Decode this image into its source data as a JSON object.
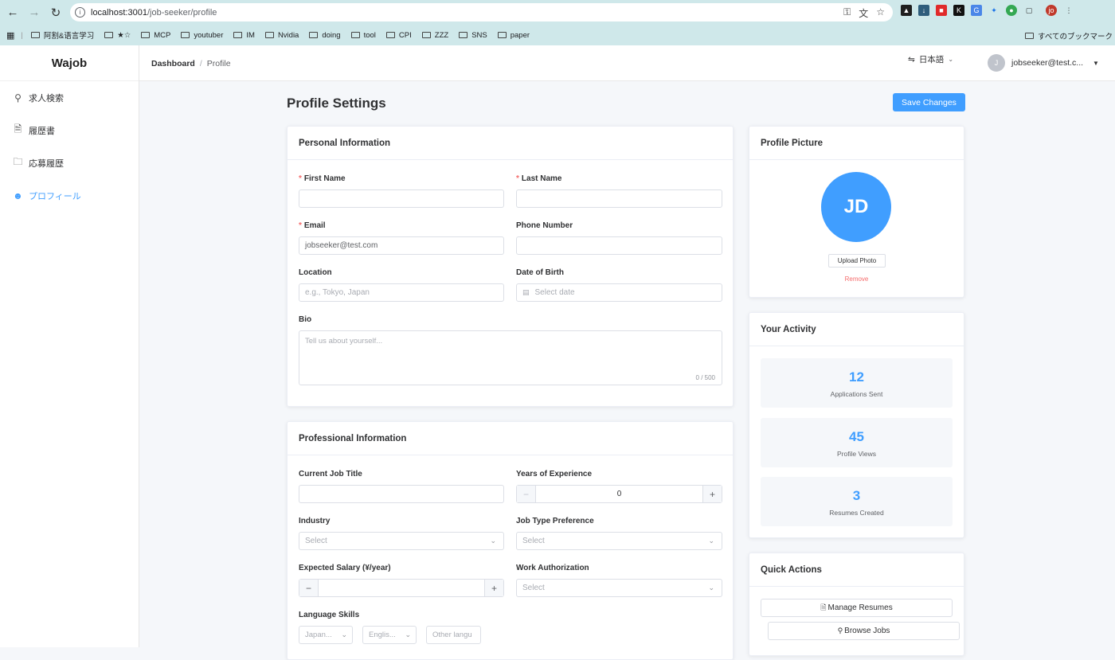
{
  "browser": {
    "url_host": "localhost:3001",
    "url_path": "/job-seeker/profile",
    "bookmarks": [
      "阿割&语言学习",
      "★☆",
      "MCP",
      "youtuber",
      "IM",
      "Nvidia",
      "doing",
      "tool",
      "CPI",
      "ZZZ",
      "SNS",
      "paper"
    ],
    "bookmarks_right": "すべてのブックマーク"
  },
  "app": {
    "name": "Wajob",
    "menu": [
      {
        "label": "求人検索",
        "icon": "search-icon"
      },
      {
        "label": "履歴書",
        "icon": "document-icon"
      },
      {
        "label": "応募履歴",
        "icon": "folder-icon"
      },
      {
        "label": "プロフィール",
        "icon": "user-icon"
      }
    ],
    "breadcrumb": {
      "root": "Dashboard",
      "current": "Profile"
    },
    "language": "日本語",
    "user": {
      "initial": "J",
      "email": "jobseeker@test.c..."
    }
  },
  "page": {
    "title": "Profile Settings",
    "save_label": "Save Changes"
  },
  "personal": {
    "title": "Personal Information",
    "first_name_label": "First Name",
    "last_name_label": "Last Name",
    "email_label": "Email",
    "email_value": "jobseeker@test.com",
    "phone_label": "Phone Number",
    "location_label": "Location",
    "location_placeholder": "e.g., Tokyo, Japan",
    "dob_label": "Date of Birth",
    "dob_placeholder": "Select date",
    "bio_label": "Bio",
    "bio_placeholder": "Tell us about yourself...",
    "bio_counter": "0 / 500"
  },
  "professional": {
    "title": "Professional Information",
    "job_title_label": "Current Job Title",
    "experience_label": "Years of Experience",
    "experience_value": "0",
    "industry_label": "Industry",
    "industry_placeholder": "Select",
    "job_type_label": "Job Type Preference",
    "job_type_placeholder": "Select",
    "salary_label": "Expected Salary (¥/year)",
    "work_auth_label": "Work Authorization",
    "work_auth_placeholder": "Select",
    "language_label": "Language Skills",
    "lang1": "Japan...",
    "lang2": "Englis...",
    "lang_other_placeholder": "Other langu"
  },
  "picture": {
    "title": "Profile Picture",
    "initials": "JD",
    "upload_label": "Upload Photo",
    "remove_label": "Remove"
  },
  "activity": {
    "title": "Your Activity",
    "stats": [
      {
        "value": "12",
        "label": "Applications Sent"
      },
      {
        "value": "45",
        "label": "Profile Views"
      },
      {
        "value": "3",
        "label": "Resumes Created"
      }
    ]
  },
  "quick": {
    "title": "Quick Actions",
    "manage_resumes": "Manage Resumes",
    "browse_jobs": "Browse Jobs"
  },
  "colors": {
    "accent": "#409eff",
    "danger": "#f56c6c"
  }
}
